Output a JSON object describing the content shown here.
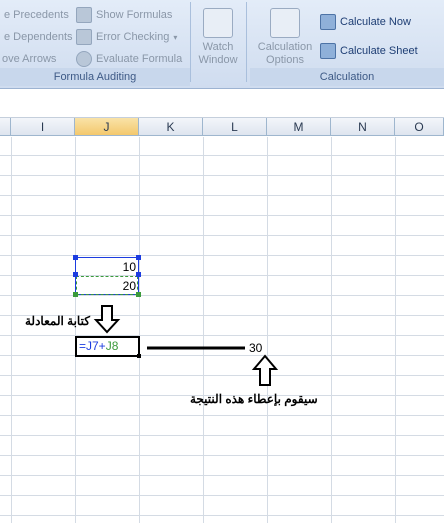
{
  "ribbon": {
    "formula_auditing": {
      "items": [
        "e Precedents",
        "e Dependents",
        "ove Arrows"
      ],
      "right_items": [
        "Show Formulas",
        "Error Checking",
        "Evaluate Formula"
      ],
      "watch_label_1": "Watch",
      "watch_label_2": "Window",
      "group_label": "Formula Auditing"
    },
    "calculation": {
      "options_label_1": "Calculation",
      "options_label_2": "Options",
      "calc_now": "Calculate Now",
      "calc_sheet": "Calculate Sheet",
      "group_label": "Calculation"
    }
  },
  "columns": [
    "I",
    "J",
    "K",
    "L",
    "M",
    "N",
    "O"
  ],
  "cells": {
    "j7": "10",
    "j8": "20",
    "active_formula_part1": "=J7+",
    "active_formula_part2": "J8",
    "result": "30"
  },
  "annotations": {
    "write_formula": "كتابة المعادلة",
    "result_note": "سيقوم بإعطاء هذه النتيجة"
  },
  "colors": {
    "ref_blue": "#1c3ce0",
    "ref_green": "#3b9a3b"
  }
}
